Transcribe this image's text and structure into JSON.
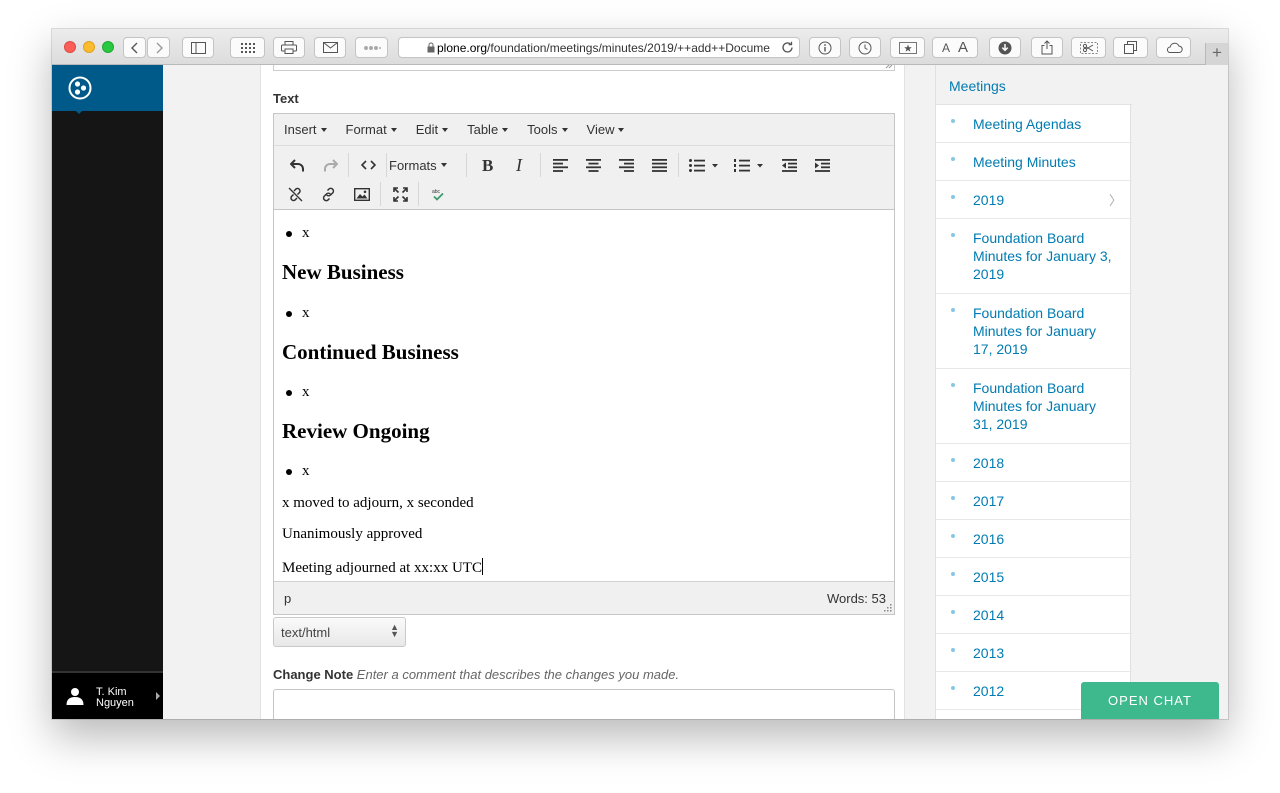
{
  "browser": {
    "url_host": "plone.org",
    "url_path": "/foundation/meetings/minutes/2019/++add++Docume",
    "new_tab_label": "+"
  },
  "plone_toolbar": {
    "user_name_line1": "T. Kim",
    "user_name_line2": "Nguyen"
  },
  "editor": {
    "field_label": "Text",
    "menus": [
      "Insert",
      "Format",
      "Edit",
      "Table",
      "Tools",
      "View"
    ],
    "formats_label": "Formats",
    "content": {
      "bullet1": "x",
      "heading_new_business": "New Business",
      "bullet2": "x",
      "heading_continued_business": "Continued Business",
      "bullet3": "x",
      "heading_review_ongoing": "Review Ongoing",
      "bullet4": "x",
      "para_adjourn": "x moved to adjourn, x seconded",
      "para_approved": "Unanimously approved",
      "para_adjourned": "Meeting adjourned at xx:xx UTC"
    },
    "status_path": "p",
    "word_count": "Words: 53",
    "mime_type": "text/html"
  },
  "change_note": {
    "label": "Change Note",
    "help": "Enter a comment that describes the changes you made."
  },
  "portlet": {
    "title": "Meetings",
    "items": [
      {
        "label": "Meeting Agendas"
      },
      {
        "label": "Meeting Minutes"
      },
      {
        "label": "2019"
      },
      {
        "label": "Foundation Board Minutes for January 3, 2019"
      },
      {
        "label": "Foundation Board Minutes for January 17, 2019"
      },
      {
        "label": "Foundation Board Minutes for January 31, 2019"
      },
      {
        "label": "2018"
      },
      {
        "label": "2017"
      },
      {
        "label": "2016"
      },
      {
        "label": "2015"
      },
      {
        "label": "2014"
      },
      {
        "label": "2013"
      },
      {
        "label": "2012"
      }
    ]
  },
  "chat": {
    "label": "OPEN CHAT"
  },
  "colors": {
    "plone_blue": "#005a89",
    "link": "#007bb1",
    "chat_green": "#3eb98d"
  }
}
